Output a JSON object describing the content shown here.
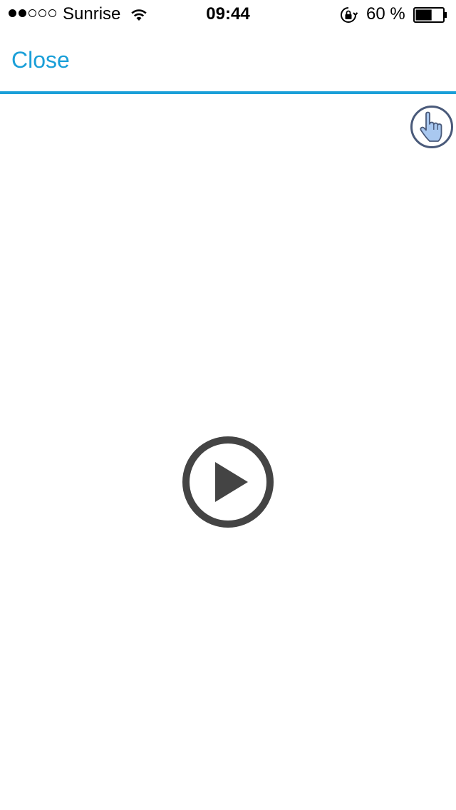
{
  "status_bar": {
    "signal_filled": 2,
    "signal_total": 5,
    "carrier": "Sunrise",
    "time": "09:44",
    "battery_percent": "60 %",
    "battery_level": 0.6,
    "icons": [
      "wifi-icon",
      "rotation-lock-icon",
      "battery-icon"
    ]
  },
  "nav": {
    "close_label": "Close"
  },
  "content": {
    "icons": [
      "pointing-hand-icon",
      "play-icon"
    ]
  },
  "colors": {
    "accent": "#1a9fd8",
    "play_icon": "#444444",
    "hand_outline": "#4a5a7a",
    "hand_fill": "#a9c8f0"
  }
}
